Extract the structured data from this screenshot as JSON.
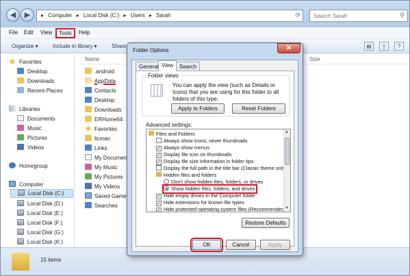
{
  "explorer": {
    "breadcrumbs": [
      "Computer",
      "Local Disk (C:)",
      "Users",
      "Sarah"
    ],
    "breadcrumb_sep": "▸",
    "search_placeholder": "Search Sarah",
    "menu": [
      "File",
      "Edit",
      "View",
      "Tools",
      "Help"
    ],
    "commands": [
      "Organize ▾",
      "Include in library ▾",
      "Share"
    ],
    "column_headers": [
      "Name",
      "Size"
    ],
    "nav": [
      {
        "label": "Favorites",
        "icon": "star-icon"
      },
      {
        "label": "Desktop",
        "icon": "desktop-folder-icon"
      },
      {
        "label": "Downloads",
        "icon": "downloads-folder-icon"
      },
      {
        "label": "Recent Places",
        "icon": "recent-places-icon"
      },
      {
        "label": "Libraries",
        "icon": "libraries-icon"
      },
      {
        "label": "Documents",
        "icon": "documents-icon"
      },
      {
        "label": "Music",
        "icon": "music-icon"
      },
      {
        "label": "Pictures",
        "icon": "pictures-icon"
      },
      {
        "label": "Videos",
        "icon": "videos-icon"
      },
      {
        "label": "Homegroup",
        "icon": "homegroup-icon"
      },
      {
        "label": "Computer",
        "icon": "computer-icon"
      },
      {
        "label": "Local Disk (C:)",
        "icon": "drive-icon"
      },
      {
        "label": "Local Disk (D:)",
        "icon": "drive-icon"
      },
      {
        "label": "Local Disk (E:)",
        "icon": "drive-icon"
      },
      {
        "label": "Local Disk (F:)",
        "icon": "drive-icon"
      },
      {
        "label": "Local Disk (G:)",
        "icon": "drive-icon"
      },
      {
        "label": "Local Disk (K:)",
        "icon": "drive-icon"
      }
    ],
    "files": [
      ".android",
      "AppData",
      "Contacts",
      "Desktop",
      "Downloads",
      "ERHome64",
      "Favorites",
      "licman",
      "Links",
      "My Document",
      "My Music",
      "My Pictures",
      "My Videos",
      "Saved Games",
      "Searches"
    ],
    "status_items": "15 items"
  },
  "dialog": {
    "title": "Folder Options",
    "close_glyph": "✕",
    "tabs": [
      "General",
      "View",
      "Search"
    ],
    "folder_views_label": "Folder views",
    "folder_views_desc": "You can apply the view (such as Details or Icons) that you are using for this folder to all folders of this type.",
    "apply_to_folders": "Apply to Folders",
    "reset_folders": "Reset Folders",
    "advanced_label": "Advanced settings:",
    "advanced_items": [
      {
        "type": "folder",
        "label": "Files and Folders"
      },
      {
        "type": "checkbox",
        "checked": false,
        "label": "Always show icons, never thumbnails"
      },
      {
        "type": "checkbox",
        "checked": true,
        "label": "Always show menus"
      },
      {
        "type": "checkbox",
        "checked": true,
        "label": "Display file icon on thumbnails"
      },
      {
        "type": "checkbox",
        "checked": true,
        "label": "Display file size information in folder tips"
      },
      {
        "type": "checkbox",
        "checked": false,
        "label": "Display the full path in the title bar (Classic theme only)"
      },
      {
        "type": "folder",
        "label": "Hidden files and folders"
      },
      {
        "type": "radio",
        "checked": false,
        "label": "Don't show hidden files, folders, or drives"
      },
      {
        "type": "radio",
        "checked": true,
        "label": "Show hidden files, folders, and drives"
      },
      {
        "type": "checkbox",
        "checked": true,
        "label": "Hide empty drives in the Computer folder"
      },
      {
        "type": "checkbox",
        "checked": true,
        "label": "Hide extensions for known file types"
      },
      {
        "type": "checkbox",
        "checked": true,
        "label": "Hide protected operating system files (Recommended)"
      }
    ],
    "restore_defaults": "Restore Defaults",
    "ok": "OK",
    "cancel": "Cancel",
    "apply": "Apply"
  },
  "colors": {
    "highlight_red": "#d8142a",
    "selection": "#cce3f7"
  }
}
